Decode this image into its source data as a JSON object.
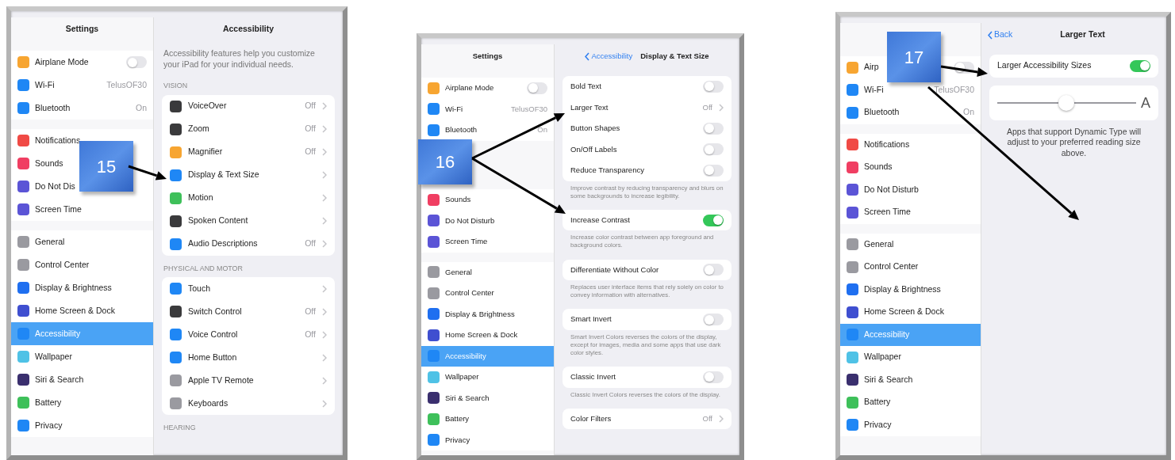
{
  "panels": [
    {
      "callout": "15",
      "sidebar": {
        "title": "Settings",
        "groups": [
          [
            {
              "label": "Airplane Mode",
              "color": "#f7a531",
              "kind": "toggle",
              "on": false,
              "selected": false
            },
            {
              "label": "Wi-Fi",
              "color": "#1f87f5",
              "kind": "value",
              "value": "TelusOF30",
              "selected": false
            },
            {
              "label": "Bluetooth",
              "color": "#1f87f5",
              "kind": "value",
              "value": "On",
              "selected": false
            }
          ],
          [
            {
              "label": "Notifications",
              "color": "#f04a45",
              "kind": "plain",
              "selected": false
            },
            {
              "label": "Sounds",
              "color": "#f03e62",
              "kind": "plain",
              "selected": false
            },
            {
              "label": "Do Not Dis",
              "color": "#5b54d6",
              "kind": "plain",
              "selected": false
            },
            {
              "label": "Screen Time",
              "color": "#5b54d6",
              "kind": "plain",
              "selected": false
            }
          ],
          [
            {
              "label": "General",
              "color": "#9a9aa0",
              "kind": "plain",
              "selected": false
            },
            {
              "label": "Control Center",
              "color": "#9a9aa0",
              "kind": "plain",
              "selected": false
            },
            {
              "label": "Display & Brightness",
              "color": "#1f6ff0",
              "kind": "plain",
              "selected": false
            },
            {
              "label": "Home Screen & Dock",
              "color": "#3f4fd0",
              "kind": "plain",
              "selected": false
            },
            {
              "label": "Accessibility",
              "color": "#1f87f5",
              "kind": "plain",
              "selected": true
            },
            {
              "label": "Wallpaper",
              "color": "#4fc2e6",
              "kind": "plain",
              "selected": false
            },
            {
              "label": "Siri & Search",
              "color": "#3a2f6e",
              "kind": "plain",
              "selected": false
            },
            {
              "label": "Battery",
              "color": "#3ec05a",
              "kind": "plain",
              "selected": false
            },
            {
              "label": "Privacy",
              "color": "#1f87f5",
              "kind": "plain",
              "selected": false
            }
          ]
        ]
      },
      "detail": {
        "title": "Accessibility",
        "intro": "Accessibility features help you customize your iPad for your individual needs.",
        "groups": [
          {
            "header": "VISION",
            "rows": [
              {
                "label": "VoiceOver",
                "color": "#3a3a3c",
                "kind": "value",
                "value": "Off"
              },
              {
                "label": "Zoom",
                "color": "#3a3a3c",
                "kind": "value",
                "value": "Off"
              },
              {
                "label": "Magnifier",
                "color": "#f7a531",
                "kind": "value",
                "value": "Off"
              },
              {
                "label": "Display & Text Size",
                "color": "#1f87f5",
                "kind": "link"
              },
              {
                "label": "Motion",
                "color": "#3ec05a",
                "kind": "link"
              },
              {
                "label": "Spoken Content",
                "color": "#3a3a3c",
                "kind": "link"
              },
              {
                "label": "Audio Descriptions",
                "color": "#1f87f5",
                "kind": "value",
                "value": "Off"
              }
            ]
          },
          {
            "header": "PHYSICAL AND MOTOR",
            "rows": [
              {
                "label": "Touch",
                "color": "#1f87f5",
                "kind": "link"
              },
              {
                "label": "Switch Control",
                "color": "#3a3a3c",
                "kind": "value",
                "value": "Off"
              },
              {
                "label": "Voice Control",
                "color": "#1f87f5",
                "kind": "value",
                "value": "Off"
              },
              {
                "label": "Home Button",
                "color": "#1f87f5",
                "kind": "link"
              },
              {
                "label": "Apple TV Remote",
                "color": "#9a9aa0",
                "kind": "link"
              },
              {
                "label": "Keyboards",
                "color": "#9a9aa0",
                "kind": "link"
              }
            ]
          },
          {
            "header": "HEARING"
          }
        ]
      }
    },
    {
      "callout": "16",
      "sidebar": {
        "title": "Settings",
        "groups": [
          [
            {
              "label": "Airplane Mode",
              "color": "#f7a531",
              "kind": "toggle",
              "on": false,
              "selected": false
            },
            {
              "label": "Wi-Fi",
              "color": "#1f87f5",
              "kind": "value",
              "value": "TelusOF30",
              "selected": false
            },
            {
              "label": "Bluetooth",
              "color": "#1f87f5",
              "kind": "value",
              "value": "On",
              "selected": false
            }
          ],
          [
            {
              "label": "Sounds",
              "color": "#f03e62",
              "kind": "plain",
              "selected": false
            },
            {
              "label": "Do Not Disturb",
              "color": "#5b54d6",
              "kind": "plain",
              "selected": false
            },
            {
              "label": "Screen Time",
              "color": "#5b54d6",
              "kind": "plain",
              "selected": false
            }
          ],
          [
            {
              "label": "General",
              "color": "#9a9aa0",
              "kind": "plain",
              "selected": false
            },
            {
              "label": "Control Center",
              "color": "#9a9aa0",
              "kind": "plain",
              "selected": false
            },
            {
              "label": "Display & Brightness",
              "color": "#1f6ff0",
              "kind": "plain",
              "selected": false
            },
            {
              "label": "Home Screen & Dock",
              "color": "#3f4fd0",
              "kind": "plain",
              "selected": false
            },
            {
              "label": "Accessibility",
              "color": "#1f87f5",
              "kind": "plain",
              "selected": true
            },
            {
              "label": "Wallpaper",
              "color": "#4fc2e6",
              "kind": "plain",
              "selected": false
            },
            {
              "label": "Siri & Search",
              "color": "#3a2f6e",
              "kind": "plain",
              "selected": false
            },
            {
              "label": "Battery",
              "color": "#3ec05a",
              "kind": "plain",
              "selected": false
            },
            {
              "label": "Privacy",
              "color": "#1f87f5",
              "kind": "plain",
              "selected": false
            }
          ]
        ]
      },
      "detail": {
        "back": "Accessibility",
        "title": "Display & Text Size",
        "groups": [
          {
            "rows": [
              {
                "label": "Bold Text",
                "kind": "toggle",
                "on": false
              },
              {
                "label": "Larger Text",
                "kind": "value",
                "value": "Off"
              },
              {
                "label": "Button Shapes",
                "kind": "toggle",
                "on": false
              },
              {
                "label": "On/Off Labels",
                "kind": "toggle",
                "on": false
              },
              {
                "label": "Reduce Transparency",
                "kind": "toggle",
                "on": false
              }
            ],
            "footer": "Improve contrast by reducing transparency and blurs on some backgrounds to increase legibility."
          },
          {
            "rows": [
              {
                "label": "Increase Contrast",
                "kind": "toggle",
                "on": true
              }
            ],
            "footer": "Increase color contrast between app foreground and background colors."
          },
          {
            "rows": [
              {
                "label": "Differentiate Without Color",
                "kind": "toggle",
                "on": false
              }
            ],
            "footer": "Replaces user interface items that rely solely on color to convey information with alternatives."
          },
          {
            "rows": [
              {
                "label": "Smart Invert",
                "kind": "toggle",
                "on": false
              }
            ],
            "footer": "Smart Invert Colors reverses the colors of the display, except for images, media and some apps that use dark color styles."
          },
          {
            "rows": [
              {
                "label": "Classic Invert",
                "kind": "toggle",
                "on": false
              }
            ],
            "footer": "Classic Invert Colors reverses the colors of the display."
          },
          {
            "rows": [
              {
                "label": "Color Filters",
                "kind": "value",
                "value": "Off"
              }
            ]
          }
        ]
      }
    },
    {
      "callout": "17",
      "sidebar": {
        "groups": [
          [
            {
              "label": "Airp",
              "color": "#f7a531",
              "kind": "toggle",
              "on": false,
              "selected": false
            },
            {
              "label": "Wi-Fi",
              "color": "#1f87f5",
              "kind": "value",
              "value": "TelusOF30",
              "selected": false
            },
            {
              "label": "Bluetooth",
              "color": "#1f87f5",
              "kind": "value",
              "value": "On",
              "selected": false
            }
          ],
          [
            {
              "label": "Notifications",
              "color": "#f04a45",
              "kind": "plain",
              "selected": false
            },
            {
              "label": "Sounds",
              "color": "#f03e62",
              "kind": "plain",
              "selected": false
            },
            {
              "label": "Do Not Disturb",
              "color": "#5b54d6",
              "kind": "plain",
              "selected": false
            },
            {
              "label": "Screen Time",
              "color": "#5b54d6",
              "kind": "plain",
              "selected": false
            }
          ],
          [
            {
              "label": "General",
              "color": "#9a9aa0",
              "kind": "plain",
              "selected": false
            },
            {
              "label": "Control Center",
              "color": "#9a9aa0",
              "kind": "plain",
              "selected": false
            },
            {
              "label": "Display & Brightness",
              "color": "#1f6ff0",
              "kind": "plain",
              "selected": false
            },
            {
              "label": "Home Screen & Dock",
              "color": "#3f4fd0",
              "kind": "plain",
              "selected": false
            },
            {
              "label": "Accessibility",
              "color": "#1f87f5",
              "kind": "plain",
              "selected": true
            },
            {
              "label": "Wallpaper",
              "color": "#4fc2e6",
              "kind": "plain",
              "selected": false
            },
            {
              "label": "Siri & Search",
              "color": "#3a2f6e",
              "kind": "plain",
              "selected": false
            },
            {
              "label": "Battery",
              "color": "#3ec05a",
              "kind": "plain",
              "selected": false
            },
            {
              "label": "Privacy",
              "color": "#1f87f5",
              "kind": "plain",
              "selected": false
            }
          ]
        ]
      },
      "detail": {
        "back": "Back",
        "title": "Larger Text",
        "groups": [
          {
            "rows": [
              {
                "label": "Larger Accessibility Sizes",
                "kind": "toggle",
                "on": true
              }
            ]
          },
          {
            "rows": [
              {
                "kind": "slider",
                "level": 0.5,
                "large_label": "A"
              }
            ],
            "footer": "Apps that support Dynamic Type will adjust to your preferred reading size above."
          }
        ]
      }
    }
  ]
}
